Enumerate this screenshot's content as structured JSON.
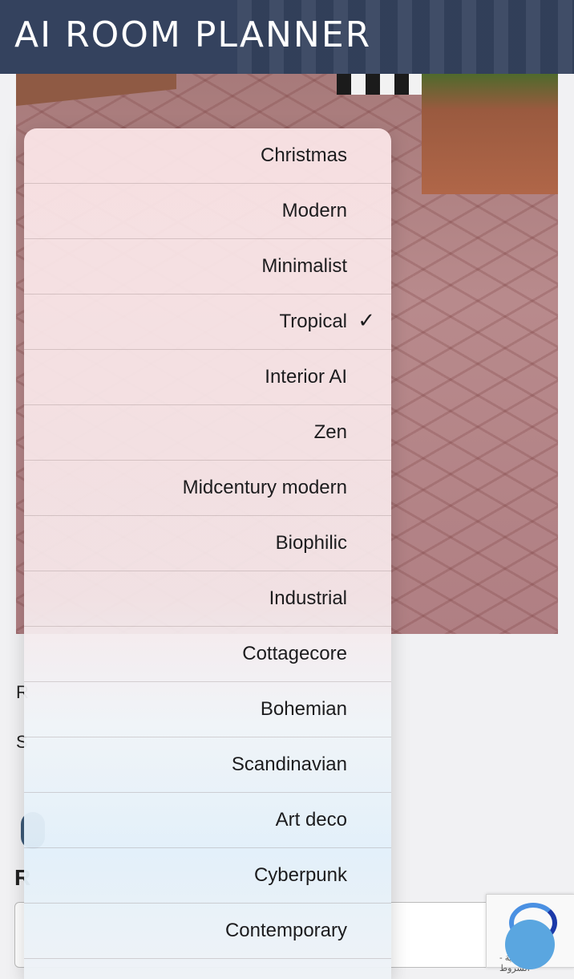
{
  "header": {
    "title": "AI ROOM PLANNER"
  },
  "picker": {
    "options": [
      "Christmas",
      "Modern",
      "Minimalist",
      "Tropical",
      "Interior AI",
      "Zen",
      "Midcentury modern",
      "Biophilic",
      "Industrial",
      "Cottagecore",
      "Bohemian",
      "Scandinavian",
      "Art deco",
      "Cyberpunk",
      "Contemporary"
    ],
    "selected": "Tropical",
    "check_glyph": "✓"
  },
  "background": {
    "label_r": "R",
    "label_s": "S",
    "heading_r": "R",
    "recaptcha_text": "الخصوصية - الشروط"
  }
}
